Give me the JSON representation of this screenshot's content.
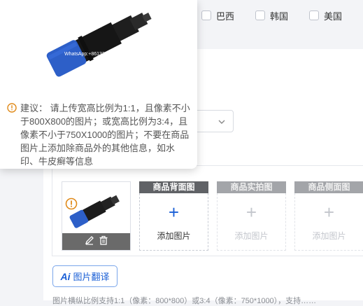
{
  "countries": [
    {
      "label": "巴西",
      "checked": false
    },
    {
      "label": "韩国",
      "checked": false
    },
    {
      "label": "美国",
      "checked": false
    }
  ],
  "popover": {
    "tip_title": "建议：",
    "tip_body": "请上传宽高比例为1:1，且像素不小于800X800的图片；或宽高比例为3:4，且像素不小于750X1000的图片；不要在商品图片上添加除商品外的其他信息，如水印、牛皮癣等信息",
    "watermark": "WhatsApp:+8613332502386"
  },
  "image_slots": [
    {
      "header": "商品背面图",
      "label": "添加图片",
      "state": "active"
    },
    {
      "header": "商品实拍图",
      "label": "添加图片",
      "state": "disabled"
    },
    {
      "header": "商品侧面图",
      "label": "添加图片",
      "state": "disabled"
    }
  ],
  "plus_glyph": "+",
  "translate_button": {
    "ai": "Ai",
    "label": "图片翻译"
  },
  "footnote": "图片横纵比例支持1:1（像素：800*800）或3:4（像素：750*1000），支持……",
  "colors": {
    "accent": "#1a5fd6",
    "warning": "#e08a1a",
    "product_blue": "#2d5fc8"
  }
}
